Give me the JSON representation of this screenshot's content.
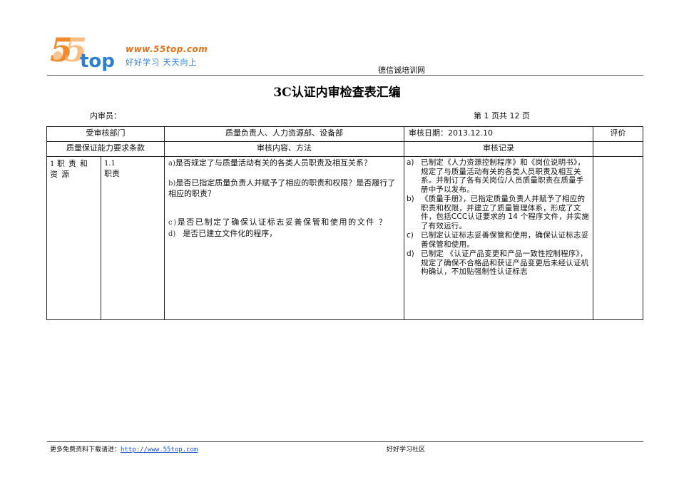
{
  "header": {
    "logo": {
      "brand": "55top",
      "url": "www.55top.com",
      "slogan": "好好学习  天天向上"
    },
    "site_name": "德信诚培训网",
    "colors": {
      "logo_orange": "#f08a2c",
      "logo_blue": "#2f7fd0",
      "link_blue": "#1a4fcc"
    }
  },
  "title": "3C认证内审检查表汇编",
  "meta": {
    "auditor_label": "内审员：",
    "page_label": "第 1  页共 12  页"
  },
  "table": {
    "header_row": {
      "dept_label": "受审核部门",
      "dept_value": "质量负责人、人力资源部、设备部",
      "date_label": "审核日期：2013.12.10",
      "eval_label": "评价"
    },
    "sub_header_row": {
      "clause_label": "质量保证能力要求条款",
      "content_label": "审核内容、方法",
      "record_label": "审核记录"
    },
    "row": {
      "section_num": "1",
      "section_text": "职责和资源",
      "sub_num": "1.1",
      "sub_text": "职责",
      "questions": [
        {
          "mark": "a)",
          "text": "是否规定了与质量活动有关的各类人员职责及相互关系？"
        },
        {
          "mark": "b)",
          "text": "是否已指定质量负责人并赋予了相应的职责和权限？是否履行了相应的职责？"
        },
        {
          "mark": "c)",
          "text": "是否已制定了确保认证标志妥善保管和使用的文件 ？"
        },
        {
          "mark": "d)",
          "text": "是否已建立文件化的程序，"
        }
      ],
      "records": [
        {
          "mark": "a)",
          "text": "已制定《人力资源控制程序》和《岗位说明书》，规定了与质量活动有关的各类人员职责及相互关系。并制订了各有关岗位/人员质量职责在质量手册中予以发布。"
        },
        {
          "mark": "b)",
          "text": "《质量手册》，已指定质量负责人并赋予了相应的职责和权限，并建立了质量管理体系，形成了文件，包括CCC认证要求的 14 个程序文件，并实施了有效运行。"
        },
        {
          "mark": "c)",
          "text": "已制定认证标志妥善保管和使用，确保认证标志妥善保管和使用。"
        },
        {
          "mark": "d)",
          "text": "已制定 《认证产品变更和产品一致性控制程序》，规定了确保不合格品和获证产品变更后未经认证机构确认，不加贴强制性认证标志"
        }
      ],
      "evaluation": ""
    }
  },
  "footer": {
    "left_text": "更多免费资料下载请进：",
    "left_link": "http://www.55top.com",
    "right_text": "好好学习社区"
  }
}
